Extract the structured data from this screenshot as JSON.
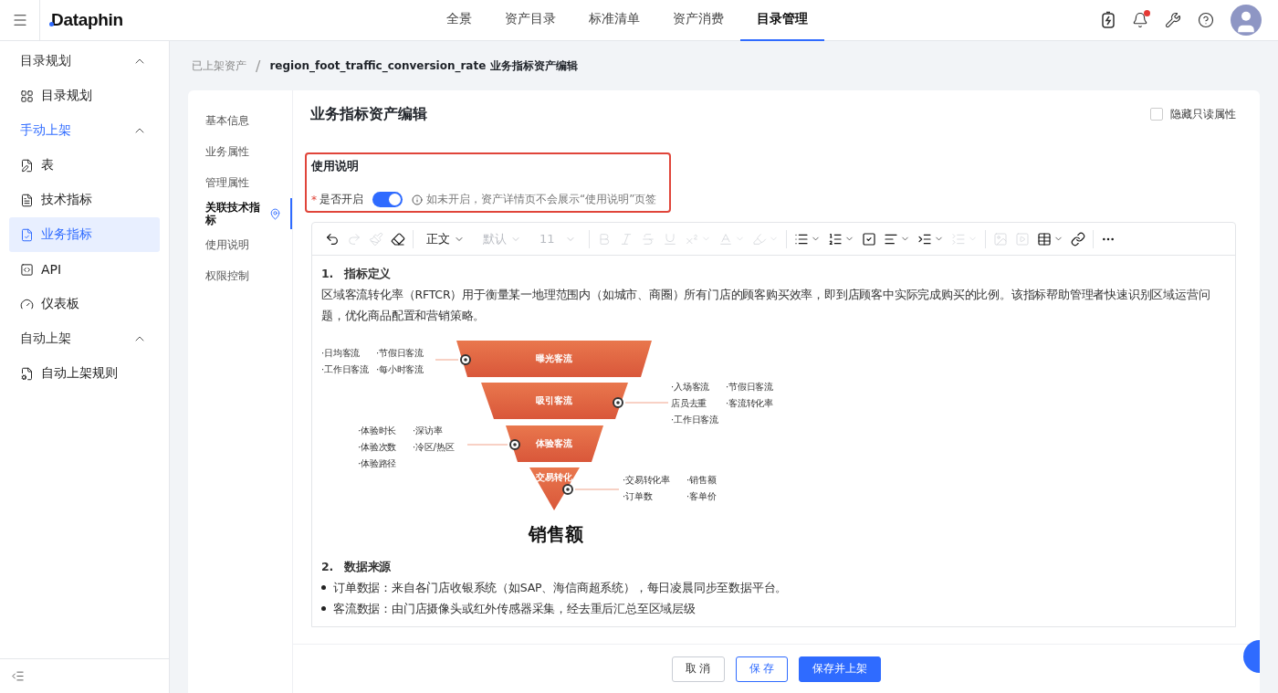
{
  "topbar": {
    "logo": "Dataphin",
    "tabs": [
      {
        "label": "全景",
        "selected": false
      },
      {
        "label": "资产目录",
        "selected": false
      },
      {
        "label": "标准清单",
        "selected": false
      },
      {
        "label": "资产消费",
        "selected": false
      },
      {
        "label": "目录管理",
        "selected": true
      }
    ],
    "notifications_unread": true
  },
  "sidebar": {
    "groups": [
      {
        "label": "目录规划",
        "expanded": true,
        "selected": false,
        "items": [
          {
            "label": "目录规划",
            "selected": false
          }
        ]
      },
      {
        "label": "手动上架",
        "expanded": true,
        "selected": true,
        "items": [
          {
            "label": "表",
            "selected": false
          },
          {
            "label": "技术指标",
            "selected": false
          },
          {
            "label": "业务指标",
            "selected": true
          },
          {
            "label": "API",
            "selected": false
          },
          {
            "label": "仪表板",
            "selected": false
          }
        ]
      },
      {
        "label": "自动上架",
        "expanded": true,
        "selected": false,
        "items": [
          {
            "label": "自动上架规则",
            "selected": false
          }
        ]
      }
    ]
  },
  "breadcrumb": [
    {
      "label": "已上架资产"
    },
    {
      "label": "region_foot_traffic_conversion_rate 业务指标资产编辑"
    }
  ],
  "breadcrumb_separator": "/",
  "anchors": [
    {
      "label": "基本信息",
      "selected": false
    },
    {
      "label": "业务属性",
      "selected": false
    },
    {
      "label": "管理属性",
      "selected": false
    },
    {
      "label": "关联技术指标",
      "selected": true
    },
    {
      "label": "使用说明",
      "selected": false
    },
    {
      "label": "权限控制",
      "selected": false
    }
  ],
  "page_title": "业务指标资产编辑",
  "hide_readonly": {
    "label": "隐藏只读属性",
    "checked": false
  },
  "usage_section": {
    "title": "使用说明",
    "field_label": "是否开启",
    "required": true,
    "required_mark": "*",
    "on": true,
    "hint": "如未开启，资产详情页不会展示“使用说明”页签"
  },
  "toolbar": [
    {
      "kind": "icon",
      "disabled": false
    },
    {
      "kind": "icon",
      "disabled": true
    },
    {
      "kind": "icon",
      "disabled": true
    },
    {
      "kind": "icon",
      "disabled": false
    },
    {
      "kind": "divider"
    },
    {
      "kind": "select",
      "label": "正文",
      "disabled": false
    },
    {
      "kind": "select",
      "label": "默认",
      "disabled": true
    },
    {
      "kind": "select",
      "label": "11",
      "disabled": true
    },
    {
      "kind": "divider"
    },
    {
      "kind": "icon",
      "disabled": true
    },
    {
      "kind": "icon",
      "disabled": true
    },
    {
      "kind": "icon",
      "disabled": true
    },
    {
      "kind": "icon",
      "disabled": true
    },
    {
      "kind": "icon",
      "disabled": true
    },
    {
      "kind": "icon",
      "disabled": true
    },
    {
      "kind": "icon",
      "disabled": true
    },
    {
      "kind": "divider"
    },
    {
      "kind": "icon",
      "disabled": false
    },
    {
      "kind": "icon",
      "disabled": false
    },
    {
      "kind": "icon",
      "disabled": false
    },
    {
      "kind": "icon",
      "disabled": false
    },
    {
      "kind": "icon",
      "disabled": false
    },
    {
      "kind": "icon",
      "disabled": true
    },
    {
      "kind": "divider"
    },
    {
      "kind": "icon",
      "disabled": true
    },
    {
      "kind": "icon",
      "disabled": true
    },
    {
      "kind": "icon",
      "disabled": false
    },
    {
      "kind": "icon",
      "disabled": false
    },
    {
      "kind": "divider"
    },
    {
      "kind": "icon",
      "disabled": false
    }
  ],
  "document": {
    "sections": [
      {
        "number": "1.",
        "heading": "指标定义",
        "paragraph": "区域客流转化率（RFTCR）用于衡量某一地理范围内（如城市、商圈）所有门店的顾客购买效率，即到店顾客中实际完成购买的比例。该指标帮助管理者快速识别区域运营问题，优化商品配置和营销策略。",
        "funnel": {
          "stages": [
            {
              "name": "曝光客流",
              "tags": [
                "·日均客流",
                "·节假日客流",
                "·工作日客流",
                "·每小时客流"
              ]
            },
            {
              "name": "吸引客流",
              "tags": [
                "·入场客流",
                "·节假日客流",
                "店员去重",
                "·客流转化率",
                "·工作日客流"
              ]
            },
            {
              "name": "体验客流",
              "tags": [
                "·体验时长",
                "·深访率",
                "·体验次数",
                "·冷区/热区",
                "·体验路径"
              ]
            },
            {
              "name": "交易转化",
              "tags": [
                "·交易转化率",
                "·销售额",
                "·订单数",
                "·客单价"
              ]
            }
          ],
          "result": "销售额"
        }
      },
      {
        "number": "2.",
        "heading": "数据来源",
        "bullets": [
          "订单数据：来自各门店收银系统（如SAP、海信商超系统），每日凌晨同步至数据平台。",
          "客流数据：由门店摄像头或红外传感器采集，经去重后汇总至区域层级"
        ]
      }
    ]
  },
  "footer": {
    "buttons": [
      {
        "label": "取 消",
        "kind": "default"
      },
      {
        "label": "保 存",
        "kind": "outline"
      },
      {
        "label": "保存并上架",
        "kind": "primary"
      }
    ]
  }
}
